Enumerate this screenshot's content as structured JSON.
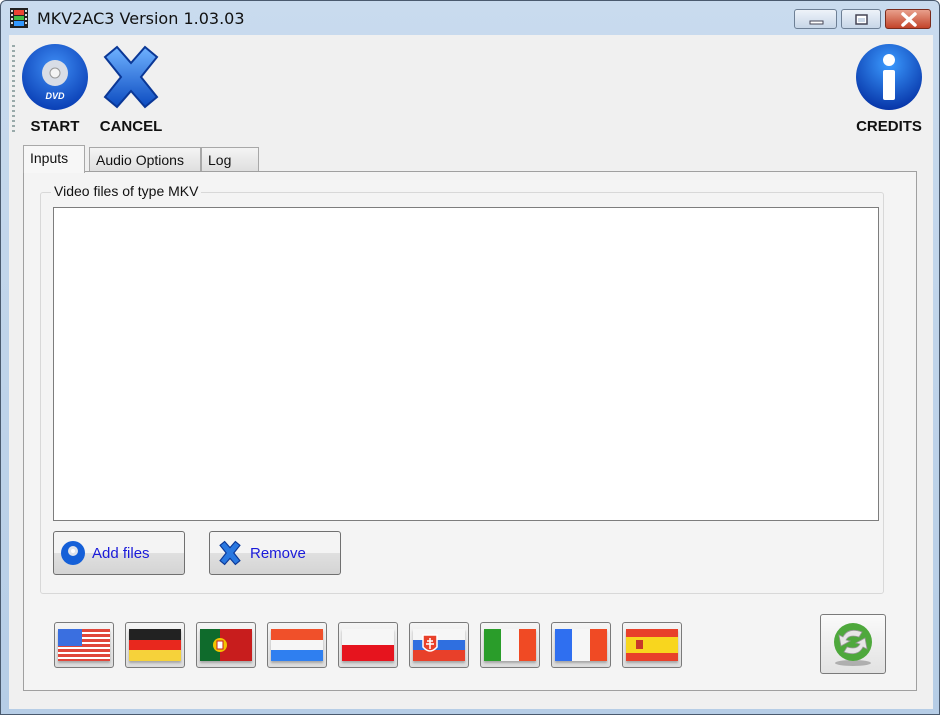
{
  "window": {
    "title": "MKV2AC3 Version 1.03.03",
    "controls": {
      "minimize": "minimize",
      "maximize": "maximize",
      "close": "close"
    }
  },
  "toolbar": {
    "start_label": "START",
    "cancel_label": "CANCEL",
    "credits_label": "CREDITS"
  },
  "tabs": [
    {
      "label": "Inputs",
      "active": true
    },
    {
      "label": "Audio Options",
      "active": false
    },
    {
      "label": "Log",
      "active": false
    }
  ],
  "inputs": {
    "group_title": "Video files of type MKV",
    "files": [],
    "add_files_label": "Add files",
    "remove_label": "Remove"
  },
  "languages": [
    {
      "name": "English (US)",
      "flag": "us"
    },
    {
      "name": "German",
      "flag": "de"
    },
    {
      "name": "Portuguese",
      "flag": "pt"
    },
    {
      "name": "Dutch",
      "flag": "nl"
    },
    {
      "name": "Polish",
      "flag": "pl"
    },
    {
      "name": "Slovak",
      "flag": "sk"
    },
    {
      "name": "Italian",
      "flag": "it"
    },
    {
      "name": "French",
      "flag": "fr"
    },
    {
      "name": "Spanish",
      "flag": "es"
    }
  ],
  "colors": {
    "accent_blue": "#1560d8",
    "button_text": "#1a1ad9",
    "refresh_green": "#4ea83c"
  }
}
